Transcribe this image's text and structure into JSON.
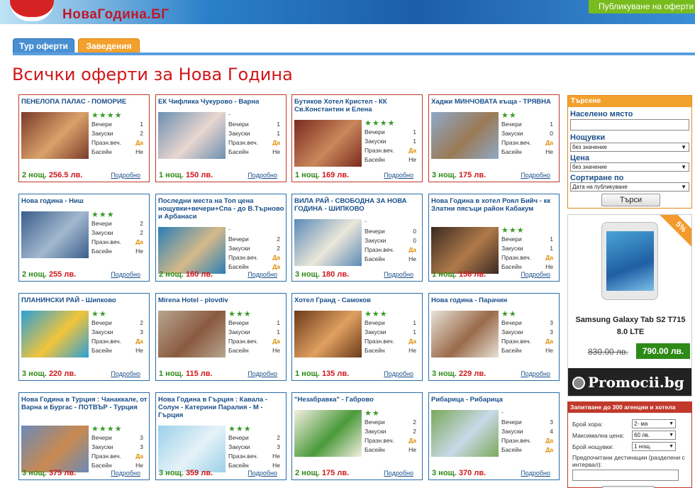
{
  "header": {
    "logo": "НоваГодина.БГ",
    "publish": "Публикуване на оферти"
  },
  "tabs": [
    {
      "label": "Тур оферти"
    },
    {
      "label": "Заведения"
    }
  ],
  "page_title": "Всички оферти за Нова Година",
  "field_labels": {
    "nights": "Вечери",
    "breakfasts": "Закуски",
    "holiday_dinner": "Празн.веч.",
    "pool": "Басейн"
  },
  "more_label": "Подробно",
  "offers": [
    {
      "title": "ПЕНЕЛОПА ПАЛАС - ПОМОРИЕ",
      "stars": "★★★★",
      "nights": "1",
      "breakfasts": "2",
      "holiday": "Да",
      "pool": "Не",
      "nights_count": "2 нощ.",
      "price": "256.5 лв.",
      "accent": "#7a3a2a",
      "accent2": "#d9a26a"
    },
    {
      "title": "ЕК Чифлика Чукурово - Варна",
      "stars": "-",
      "nights": "1",
      "breakfasts": "1",
      "holiday": "Да",
      "pool": "Не",
      "nights_count": "1 нощ.",
      "price": "150 лв.",
      "accent": "#6b8fb0",
      "accent2": "#e9d6d0"
    },
    {
      "title": "Бутиков Хотел Кристел - КК Св.Константин и Елена",
      "stars": "★★★★",
      "nights": "1",
      "breakfasts": "1",
      "holiday": "Да",
      "pool": "Не",
      "nights_count": "1 нощ.",
      "price": "169 лв.",
      "accent": "#7a2a20",
      "accent2": "#c9875a"
    },
    {
      "title": "Хаджи МИНЧОВАТА къща - ТРЯВНА",
      "stars": "★★",
      "nights": "1",
      "breakfasts": "0",
      "holiday": "Да",
      "pool": "Не",
      "nights_count": "3 нощ.",
      "price": "175 лв.",
      "accent": "#8fa9c9",
      "accent2": "#9a7a55"
    },
    {
      "title": "Нова година - Ниш",
      "stars": "★★★",
      "nights": "2",
      "breakfasts": "2",
      "holiday": "Да",
      "pool": "Не",
      "nights_count": "2 нощ.",
      "price": "255 лв.",
      "accent": "#3a5d8a",
      "accent2": "#a3b8cf"
    },
    {
      "title": "Последни места на Топ цена нощувки+вечери+Спа - до В.Търново и Арбанаси",
      "stars": "-",
      "nights": "2",
      "breakfasts": "2",
      "holiday": "Да",
      "pool": "Да",
      "nights_count": "2 нощ.",
      "price": "160 лв.",
      "accent": "#2a7fb5",
      "accent2": "#d5b98a"
    },
    {
      "title": "ВИЛА РАЙ - СВОБОДНА ЗА НОВА ГОДИНА - ШИПКОВО",
      "stars": "-",
      "nights": "0",
      "breakfasts": "0",
      "holiday": "Да",
      "pool": "Не",
      "nights_count": "3 нощ.",
      "price": "180 лв.",
      "accent": "#5a8ab8",
      "accent2": "#ece7d9"
    },
    {
      "title": "Нова Година в хотел Роял Бийч - кк Златни пясъци район Кабакум",
      "stars": "★★★",
      "nights": "1",
      "breakfasts": "1",
      "holiday": "Да",
      "pool": "Не",
      "nights_count": "1 нощ.",
      "price": "158 лв.",
      "accent": "#3a2a22",
      "accent2": "#b07a4a"
    },
    {
      "title": "ПЛАНИНСКИ РАЙ - Шипково",
      "stars": "★★",
      "nights": "2",
      "breakfasts": "3",
      "holiday": "Да",
      "pool": "Не",
      "nights_count": "3 нощ.",
      "price": "220 лв.",
      "accent": "#2aa0d8",
      "accent2": "#f2c43a"
    },
    {
      "title": "Mirena Hotel - plovdiv",
      "stars": "★★★",
      "nights": "1",
      "breakfasts": "1",
      "holiday": "Да",
      "pool": "Не",
      "nights_count": "1 нощ.",
      "price": "115 лв.",
      "accent": "#b8a590",
      "accent2": "#8a5a40"
    },
    {
      "title": "Хотел Гранд - Самоков",
      "stars": "★★★",
      "nights": "1",
      "breakfasts": "1",
      "holiday": "Да",
      "pool": "Не",
      "nights_count": "1 нощ.",
      "price": "135 лв.",
      "accent": "#6a3a1a",
      "accent2": "#e0a060"
    },
    {
      "title": "Нова година - Парачин",
      "stars": "★★",
      "nights": "3",
      "breakfasts": "3",
      "holiday": "Да",
      "pool": "Не",
      "nights_count": "3 нощ.",
      "price": "229 лв.",
      "accent": "#e8e2d8",
      "accent2": "#9a6a4a"
    },
    {
      "title": "Нова Година в Турция : Чанаккале, от Варна и Бургас - ПОТВЪР - Турция",
      "stars": "★★★★",
      "nights": "3",
      "breakfasts": "3",
      "holiday": "Да",
      "pool": "Не",
      "nights_count": "3 нощ.",
      "price": "375 лв.",
      "accent": "#6a8ab8",
      "accent2": "#c98a50"
    },
    {
      "title": "Нова Година в Гърция : Кавала - Солун - Катерини Паралия - М - Гърция",
      "stars": "★★★",
      "nights": "2",
      "breakfasts": "3",
      "holiday": "Не",
      "pool": "Не",
      "nights_count": "3 нощ.",
      "price": "359 лв.",
      "accent": "#9ad0e8",
      "accent2": "#e6f2f8"
    },
    {
      "title": "\"Незабравка\" - Габрово",
      "stars": "★★",
      "nights": "2",
      "breakfasts": "2",
      "holiday": "Да",
      "pool": "Не",
      "nights_count": "2 нощ.",
      "price": "175 лв.",
      "accent": "#f4efe2",
      "accent2": "#4a9a3a"
    },
    {
      "title": "Рибарица - Рибарица",
      "stars": "-",
      "nights": "3",
      "breakfasts": "4",
      "holiday": "Да",
      "pool": "Да",
      "nights_count": "3 нощ.",
      "price": "370 лв.",
      "accent": "#7aa85a",
      "accent2": "#c9d9e8"
    }
  ],
  "search": {
    "header": "Търсене",
    "location_label": "Населено място",
    "nights_label": "Нощувки",
    "nights_value": "без значение",
    "price_label": "Цена",
    "price_value": "без значение",
    "sort_label": "Сортиране по",
    "sort_value": "Дата на публикуване",
    "button": "Търси"
  },
  "ad": {
    "discount": "5%",
    "product": "Samsung Galaxy Tab S2 T715 8.0 LTE",
    "old_price": "830.00 лв.",
    "new_price": "790.00 лв.",
    "site": "Promocii.bg"
  },
  "request": {
    "header": "Запитване до 300 агенции и хотела",
    "people_label": "Брой хора:",
    "people_value": "2- ма",
    "maxprice_label": "Максимална цена:",
    "maxprice_value": "60 лв.",
    "nights_label": "Брой нощувки:",
    "nights_value": "1 нощ.",
    "dest_label": "Предпочитани дестинации (разделени с интервал):"
  }
}
